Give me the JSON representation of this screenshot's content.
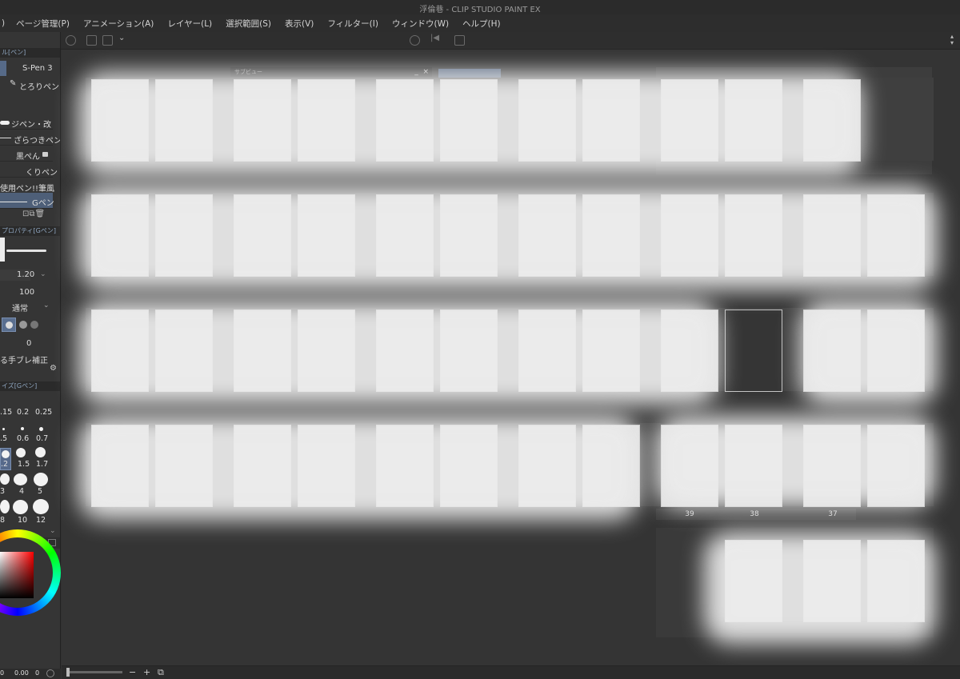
{
  "window": {
    "title": "浮倫巷 - CLIP STUDIO PAINT EX"
  },
  "menu": [
    "ページ管理(P)",
    "アニメーション(A)",
    "レイヤー(L)",
    "選択範囲(S)",
    "表示(V)",
    "フィルター(I)",
    "ウィンドウ(W)",
    "ヘルプ(H)"
  ],
  "menu_fragment": ")",
  "tool_panel": {
    "header": "ル[ペン]",
    "device": "S-Pen 3",
    "subtool": "とろりペン",
    "brushes": [
      "ジペン・改",
      "ざらつきペン",
      "黒ぺん",
      "くりペン",
      "使用ペン!!筆風",
      "Gペン"
    ],
    "selected_brush": "Gペン"
  },
  "property_panel": {
    "header": "プロパティ[Gペン]",
    "size": "1.20",
    "opacity": "100",
    "blend_mode": "通常",
    "stabilization_value": "0",
    "stabilization_label": "る手ブレ補正"
  },
  "brush_size_panel": {
    "header": "イズ[Gペン]",
    "sizes": [
      ".15",
      "0.2",
      "0.25",
      ".5",
      "0.6",
      "0.7",
      ".2",
      "1.5",
      "1.7",
      "3",
      "4",
      "5",
      "8",
      "10",
      "12"
    ],
    "selected": ".2"
  },
  "subview": {
    "title": "サブビュー",
    "minimize": "_",
    "close": "×"
  },
  "pages": {
    "visible_numbers": [
      "39",
      "38",
      "37"
    ]
  },
  "status": {
    "zoom_in": "+",
    "zoom_out": "−",
    "fit": "⧉"
  },
  "bottom_fragment": {
    "a": "0",
    "b": "0.00",
    "c": "0"
  }
}
